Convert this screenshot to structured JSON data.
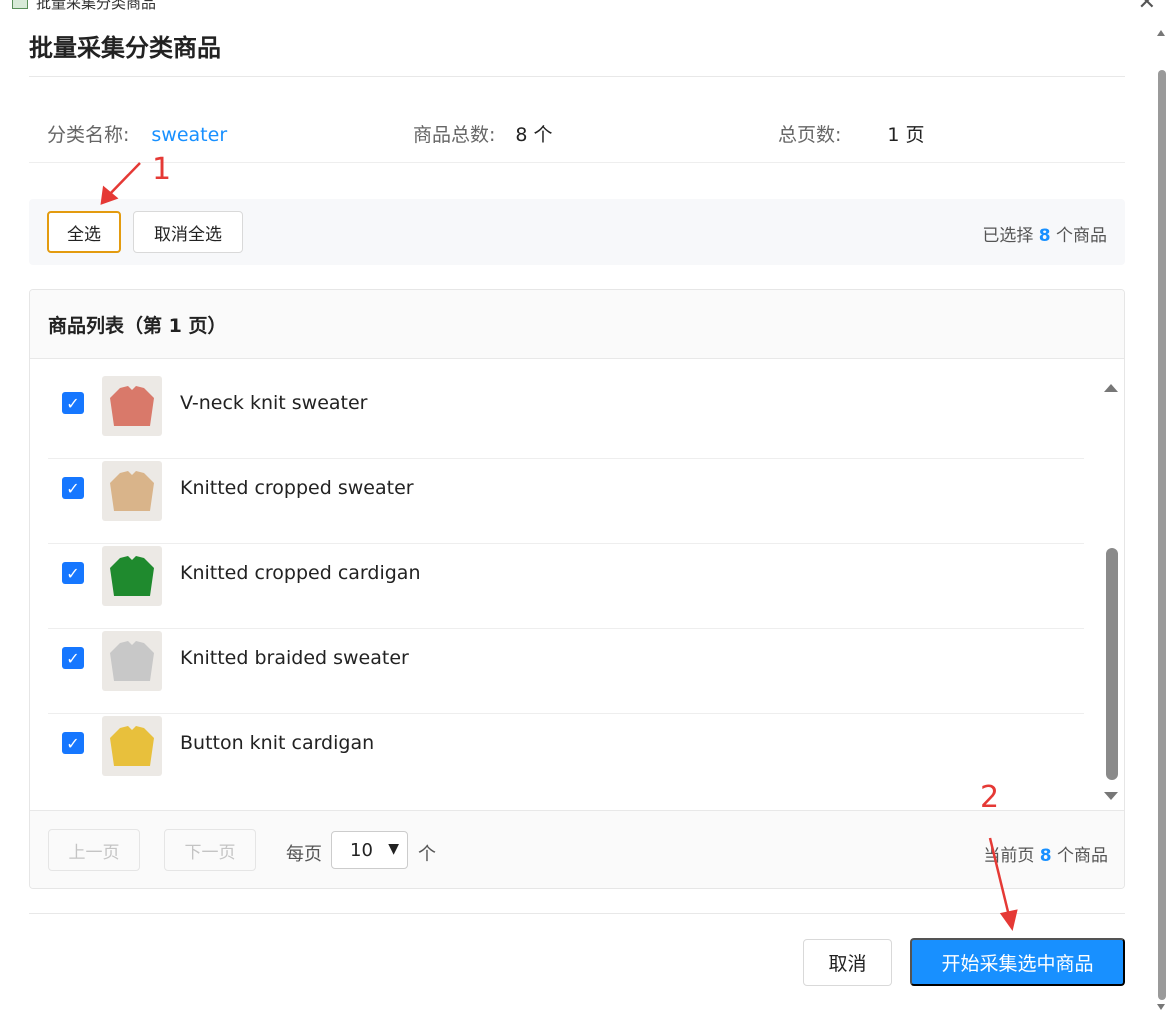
{
  "window": {
    "title": "批量采集分类商品"
  },
  "dialog": {
    "title": "批量采集分类商品"
  },
  "info": {
    "category_label": "分类名称:",
    "category_value": "sweater",
    "total_label": "商品总数:",
    "total_value": "8 个",
    "pages_label": "总页数:",
    "pages_value": "1 页"
  },
  "toolbar": {
    "select_all": "全选",
    "deselect_all": "取消全选",
    "selected_prefix": "已选择",
    "selected_count": "8",
    "selected_suffix": "个商品"
  },
  "list": {
    "header": "商品列表（第 1 页）",
    "items": [
      {
        "name": "V-neck knit sweater",
        "checked": true,
        "color": "#d9796a"
      },
      {
        "name": "Knitted cropped sweater",
        "checked": true,
        "color": "#d9b48a"
      },
      {
        "name": "Knitted cropped cardigan",
        "checked": true,
        "color": "#1f8a2e"
      },
      {
        "name": "Knitted braided sweater",
        "checked": true,
        "color": "#c8c8c8"
      },
      {
        "name": "Button knit cardigan",
        "checked": true,
        "color": "#e8c03c"
      }
    ]
  },
  "pager": {
    "prev": "上一页",
    "next": "下一页",
    "per_page_label": "每页",
    "per_page_value": "10",
    "per_page_unit": "个",
    "current_prefix": "当前页",
    "current_count": "8",
    "current_suffix": "个商品"
  },
  "footer": {
    "cancel": "取消",
    "start": "开始采集选中商品"
  },
  "annotations": {
    "marker_1": "1",
    "marker_2": "2",
    "color": "#e53935"
  }
}
